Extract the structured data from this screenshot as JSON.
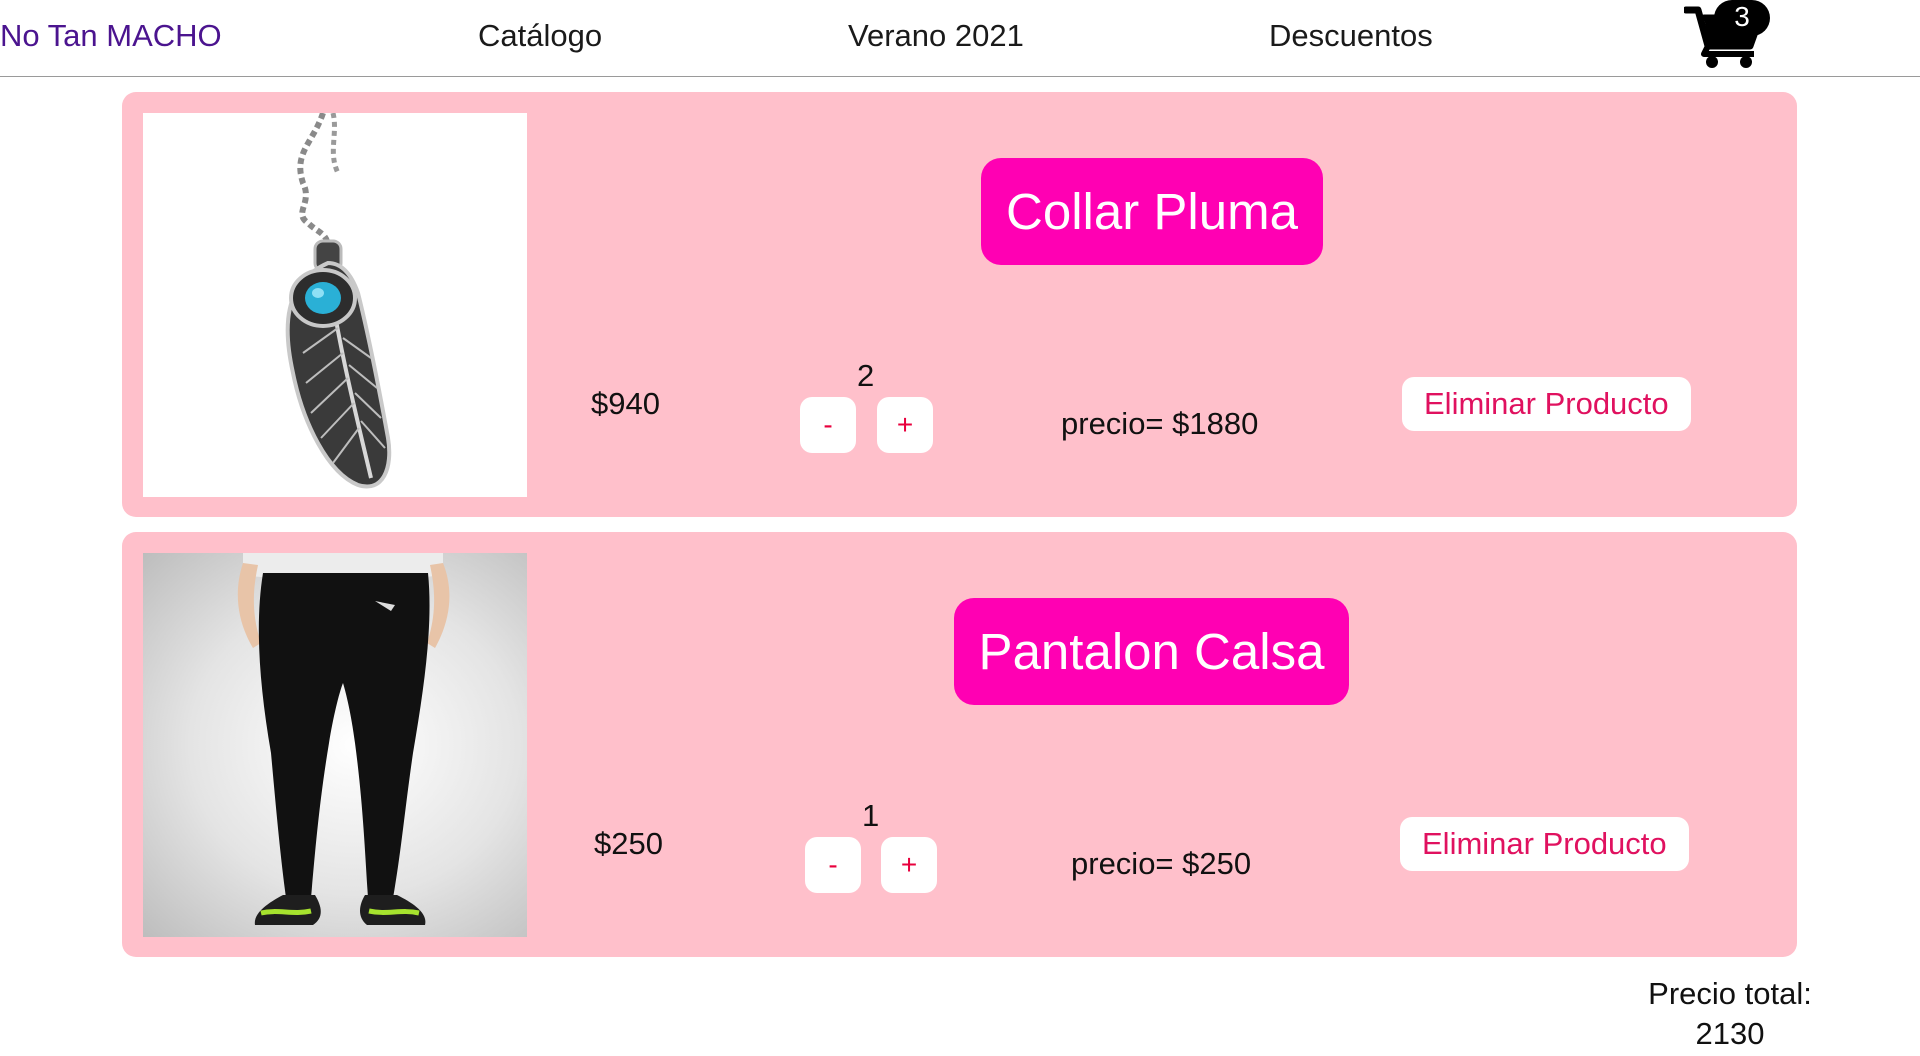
{
  "navbar": {
    "brand": "No Tan MACHO",
    "links": [
      "Catálogo",
      "Verano 2021",
      "Descuentos"
    ],
    "cart_count": "3",
    "colors": {
      "brand": "#4b148f",
      "border": "#9a9a9a"
    }
  },
  "cart": {
    "items": [
      {
        "name": "Collar Pluma",
        "image_icon": "feather-necklace-image",
        "unit_price": "$940",
        "quantity": "2",
        "minus_label": "-",
        "plus_label": "+",
        "line_total": "precio= $1880",
        "remove_label": "Eliminar Producto"
      },
      {
        "name": "Pantalon Calsa",
        "image_icon": "black-leggings-image",
        "unit_price": "$250",
        "quantity": "1",
        "minus_label": "-",
        "plus_label": "+",
        "line_total": "precio= $250",
        "remove_label": "Eliminar Producto"
      }
    ],
    "total_label": "Precio total:",
    "total_value": "2130"
  },
  "colors": {
    "card_background": "#ffc0cb",
    "name_pill": "#ff00b3",
    "button_text": "#e8003d"
  }
}
